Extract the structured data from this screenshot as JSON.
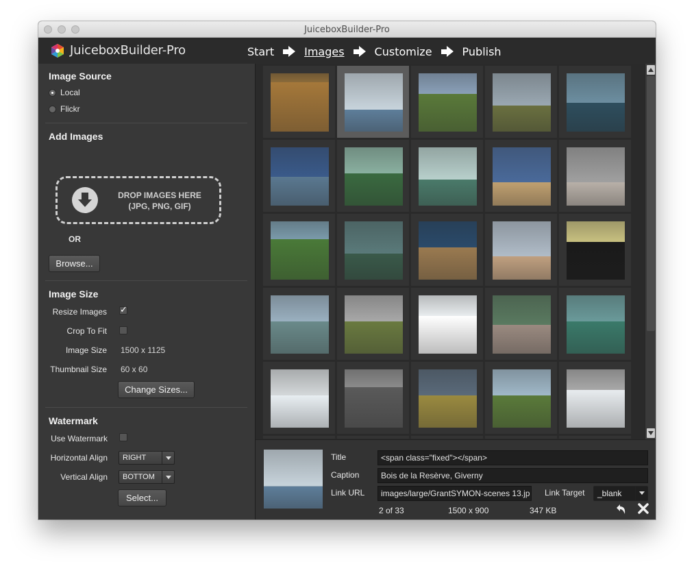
{
  "window": {
    "title": "JuiceboxBuilder-Pro"
  },
  "app": {
    "name": "JuiceboxBuilder-Pro",
    "steps": [
      {
        "label": "Start",
        "active": false
      },
      {
        "label": "Images",
        "active": true
      },
      {
        "label": "Customize",
        "active": false
      },
      {
        "label": "Publish",
        "active": false
      }
    ]
  },
  "sidebar": {
    "image_source": {
      "title": "Image Source",
      "options": [
        {
          "label": "Local",
          "selected": true
        },
        {
          "label": "Flickr",
          "selected": false
        }
      ]
    },
    "add_images": {
      "title": "Add Images",
      "drop_line1": "DROP IMAGES HERE",
      "drop_line2": "(JPG, PNG, GIF)",
      "or_label": "OR",
      "browse_label": "Browse..."
    },
    "image_size": {
      "title": "Image Size",
      "resize_label": "Resize Images",
      "resize_checked": true,
      "crop_label": "Crop To Fit",
      "crop_checked": false,
      "image_size_label": "Image Size",
      "image_size_value": "1500 x 1125",
      "thumb_size_label": "Thumbnail Size",
      "thumb_size_value": "60 x 60",
      "change_label": "Change Sizes..."
    },
    "watermark": {
      "title": "Watermark",
      "use_label": "Use Watermark",
      "use_checked": false,
      "h_align_label": "Horizontal Align",
      "h_align_value": "RIGHT",
      "v_align_label": "Vertical Align",
      "v_align_value": "BOTTOM",
      "select_label": "Select..."
    }
  },
  "gallery": {
    "selected_index": 1,
    "thumbnails": [
      {
        "sky": "#8a6a3a",
        "ground": "#a5783a",
        "horizon": 0.15
      },
      {
        "sky": "#c8d4dc",
        "ground": "#5e7e9a",
        "horizon": 0.62
      },
      {
        "sky": "#8aa0b8",
        "ground": "#5a7a3a",
        "horizon": 0.35
      },
      {
        "sky": "#9aa8b2",
        "ground": "#6a7040",
        "horizon": 0.55
      },
      {
        "sky": "#6c8ea0",
        "ground": "#2e4e5e",
        "horizon": 0.5
      },
      {
        "sky": "#3a5a8a",
        "ground": "#5a7890",
        "horizon": 0.5
      },
      {
        "sky": "#8ab0a0",
        "ground": "#3a6a40",
        "horizon": 0.45
      },
      {
        "sky": "#b8d0cc",
        "ground": "#4a7a6a",
        "horizon": 0.55
      },
      {
        "sky": "#4a6a9a",
        "ground": "#c0a070",
        "horizon": 0.6
      },
      {
        "sky": "#a0a0a0",
        "ground": "#b8b0a8",
        "horizon": 0.6
      },
      {
        "sky": "#7a9aaa",
        "ground": "#4a7a38",
        "horizon": 0.3
      },
      {
        "sky": "#5a7a7a",
        "ground": "#3a5a4a",
        "horizon": 0.55
      },
      {
        "sky": "#2a4a6a",
        "ground": "#9a7a50",
        "horizon": 0.45
      },
      {
        "sky": "#b0bcc8",
        "ground": "#c0a080",
        "horizon": 0.6
      },
      {
        "sky": "#c8c080",
        "ground": "#1a1a1a",
        "horizon": 0.35
      },
      {
        "sky": "#9ab0c0",
        "ground": "#6a8a8a",
        "horizon": 0.45
      },
      {
        "sky": "#a8a8a8",
        "ground": "#6a7a40",
        "horizon": 0.45
      },
      {
        "sky": "#e8ecee",
        "ground": "#ffffff",
        "horizon": 0.35
      },
      {
        "sky": "#5a7a60",
        "ground": "#9a8a80",
        "horizon": 0.5
      },
      {
        "sky": "#6a9a9a",
        "ground": "#3a7a6a",
        "horizon": 0.45
      },
      {
        "sky": "#d4d8da",
        "ground": "#e8eef2",
        "horizon": 0.45
      },
      {
        "sky": "#8a8a8a",
        "ground": "#5a5a5a",
        "horizon": 0.3
      },
      {
        "sky": "#5a6a7a",
        "ground": "#9a8a40",
        "horizon": 0.45
      },
      {
        "sky": "#a0b8c8",
        "ground": "#5a7a3a",
        "horizon": 0.45
      },
      {
        "sky": "#a8a8a8",
        "ground": "#e8ecef",
        "horizon": 0.35
      }
    ]
  },
  "details": {
    "title_label": "Title",
    "title_value": "<span class=\"fixed\"></span>",
    "caption_label": "Caption",
    "caption_value": "Bois de la Resèrve, Giverny",
    "link_url_label": "Link URL",
    "link_url_value": "images/large/GrantSYMON-scenes 13.jp",
    "link_target_label": "Link Target",
    "link_target_value": "_blank",
    "position": "2 of 33",
    "dimensions": "1500 x 900",
    "file_size": "347 KB",
    "thumb": {
      "sky": "#c8d4dc",
      "ground": "#5e7e9a",
      "horizon": 0.62
    }
  },
  "colors": {
    "chrome_bg": "#3a3a3a",
    "header_bg": "#2b2b2b",
    "selection": "#5c5c5c"
  }
}
